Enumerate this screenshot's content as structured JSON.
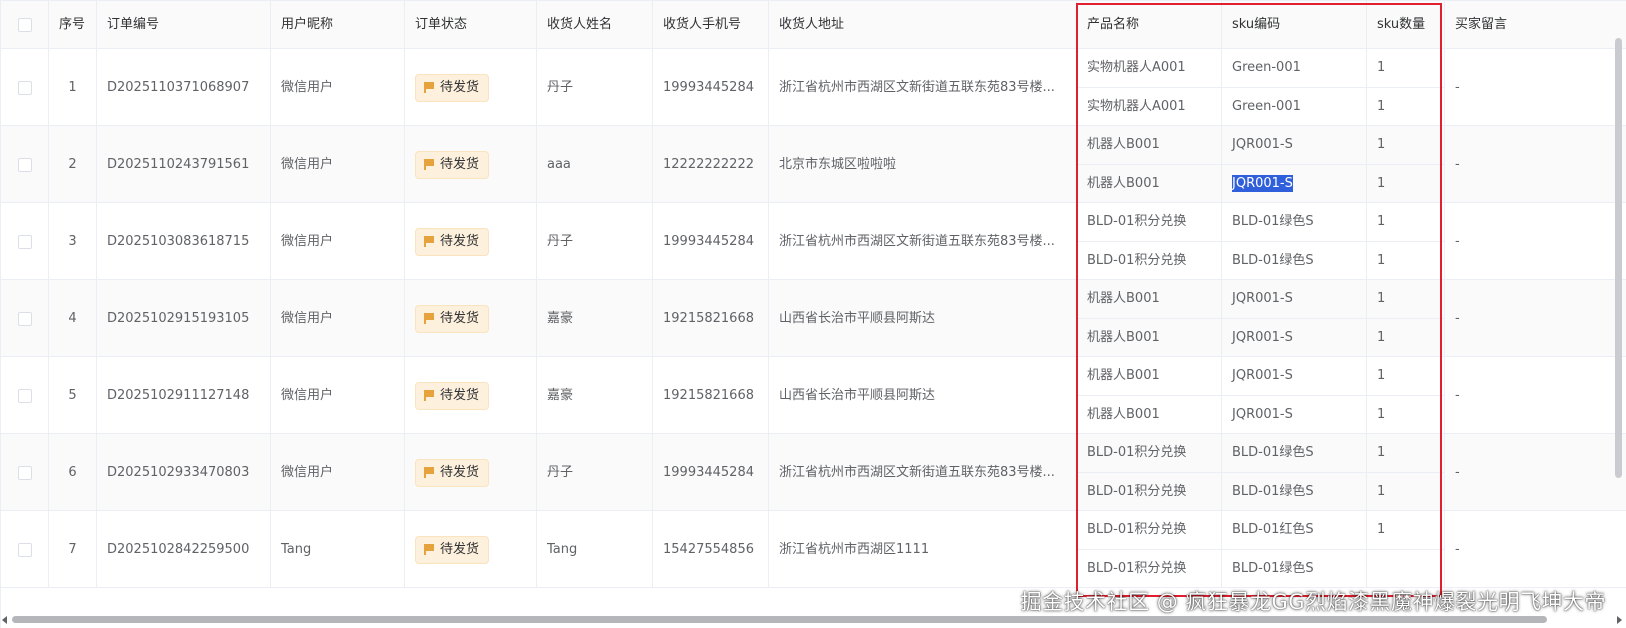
{
  "headers": [
    "序号",
    "订单编号",
    "用户昵称",
    "订单状态",
    "收货人姓名",
    "收货人手机号",
    "收货人地址",
    "产品名称",
    "sku编码",
    "sku数量",
    "买家留言"
  ],
  "rows": [
    {
      "index": "1",
      "order_no": "D2025110371068907",
      "nickname": "微信用户",
      "status": "待发货",
      "name": "丹子",
      "phone": "19993445284",
      "address": "浙江省杭州市西湖区文新街道五联东苑83号楼...",
      "message": "-",
      "items": [
        {
          "product": "实物机器人A001",
          "sku": "Green-001",
          "qty": "1"
        },
        {
          "product": "实物机器人A001",
          "sku": "Green-001",
          "qty": "1"
        }
      ]
    },
    {
      "index": "2",
      "order_no": "D2025110243791561",
      "nickname": "微信用户",
      "status": "待发货",
      "name": "aaa",
      "phone": "12222222222",
      "address": "北京市东城区啦啦啦",
      "message": "-",
      "items": [
        {
          "product": "机器人B001",
          "sku": "JQR001-S",
          "qty": "1"
        },
        {
          "product": "机器人B001",
          "sku": "JQR001-S",
          "qty": "1"
        }
      ]
    },
    {
      "index": "3",
      "order_no": "D2025103083618715",
      "nickname": "微信用户",
      "status": "待发货",
      "name": "丹子",
      "phone": "19993445284",
      "address": "浙江省杭州市西湖区文新街道五联东苑83号楼...",
      "message": "-",
      "items": [
        {
          "product": "BLD-01积分兑换",
          "sku": "BLD-01绿色S",
          "qty": "1"
        },
        {
          "product": "BLD-01积分兑换",
          "sku": "BLD-01绿色S",
          "qty": "1"
        }
      ]
    },
    {
      "index": "4",
      "order_no": "D2025102915193105",
      "nickname": "微信用户",
      "status": "待发货",
      "name": "嘉豪",
      "phone": "19215821668",
      "address": "山西省长治市平顺县阿斯达",
      "message": "-",
      "items": [
        {
          "product": "机器人B001",
          "sku": "JQR001-S",
          "qty": "1"
        },
        {
          "product": "机器人B001",
          "sku": "JQR001-S",
          "qty": "1"
        }
      ]
    },
    {
      "index": "5",
      "order_no": "D2025102911127148",
      "nickname": "微信用户",
      "status": "待发货",
      "name": "嘉豪",
      "phone": "19215821668",
      "address": "山西省长治市平顺县阿斯达",
      "message": "-",
      "items": [
        {
          "product": "机器人B001",
          "sku": "JQR001-S",
          "qty": "1"
        },
        {
          "product": "机器人B001",
          "sku": "JQR001-S",
          "qty": "1"
        }
      ]
    },
    {
      "index": "6",
      "order_no": "D2025102933470803",
      "nickname": "微信用户",
      "status": "待发货",
      "name": "丹子",
      "phone": "19993445284",
      "address": "浙江省杭州市西湖区文新街道五联东苑83号楼...",
      "message": "-",
      "items": [
        {
          "product": "BLD-01积分兑换",
          "sku": "BLD-01绿色S",
          "qty": "1"
        },
        {
          "product": "BLD-01积分兑换",
          "sku": "BLD-01绿色S",
          "qty": "1"
        }
      ]
    },
    {
      "index": "7",
      "order_no": "D2025102842259500",
      "nickname": "Tang",
      "status": "待发货",
      "name": "Tang",
      "phone": "15427554856",
      "address": "浙江省杭州市西湖区1111",
      "message": "-",
      "items": [
        {
          "product": "BLD-01积分兑换",
          "sku": "BLD-01红色S",
          "qty": "1"
        },
        {
          "product": "BLD-01积分兑换",
          "sku": "BLD-01绿色S",
          "qty": ""
        }
      ]
    }
  ],
  "watermark": "掘金技术社区 @ 疯狂暴龙GG烈焰漆黑魔神爆裂光明飞坤大帝",
  "colors": {
    "highlight_box": "#e0202e",
    "status_tag": "#e6a23c",
    "selection": "#2f5fdb"
  }
}
